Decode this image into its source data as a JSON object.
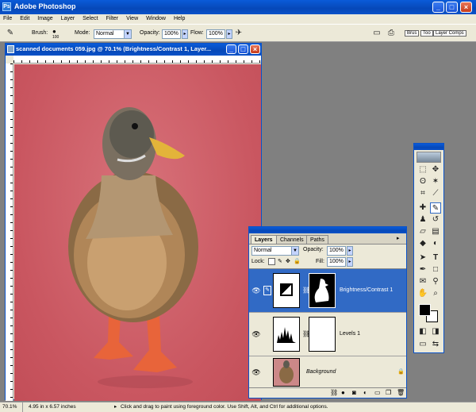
{
  "app": {
    "title": "Adobe Photoshop"
  },
  "menu": [
    "File",
    "Edit",
    "Image",
    "Layer",
    "Select",
    "Filter",
    "View",
    "Window",
    "Help"
  ],
  "options": {
    "brush_label": "Brush:",
    "brush_size": "100",
    "mode_label": "Mode:",
    "mode_value": "Normal",
    "opacity_label": "Opacity:",
    "opacity_value": "100%",
    "flow_label": "Flow:",
    "flow_value": "100%",
    "tab_brushes": "Brus",
    "tab_tool": "Too",
    "tab_comps": "Layer Comps"
  },
  "document": {
    "title": "scanned documents 059.jpg @ 70.1% (Brightness/Contrast 1, Layer..."
  },
  "layers_panel": {
    "tabs": [
      "Layers",
      "Channels",
      "Paths"
    ],
    "blend_mode": "Normal",
    "opacity_label": "Opacity:",
    "opacity_value": "100%",
    "lock_label": "Lock:",
    "fill_label": "Fill:",
    "fill_value": "100%",
    "layers": [
      {
        "name": "Brightness/Contrast 1",
        "selected": true
      },
      {
        "name": "Levels 1",
        "selected": false
      },
      {
        "name": "Background",
        "selected": false
      }
    ]
  },
  "status": {
    "zoom": "70.1%",
    "doc_info": "4.95 in x 6.57 inches",
    "hint": "Click and drag to paint using foreground color. Use Shift, Alt, and Ctrl for additional options."
  },
  "colors": {
    "accent": "#316ac5",
    "title_bar": "#0a52c9",
    "canvas_bg": "#cf5f66"
  }
}
